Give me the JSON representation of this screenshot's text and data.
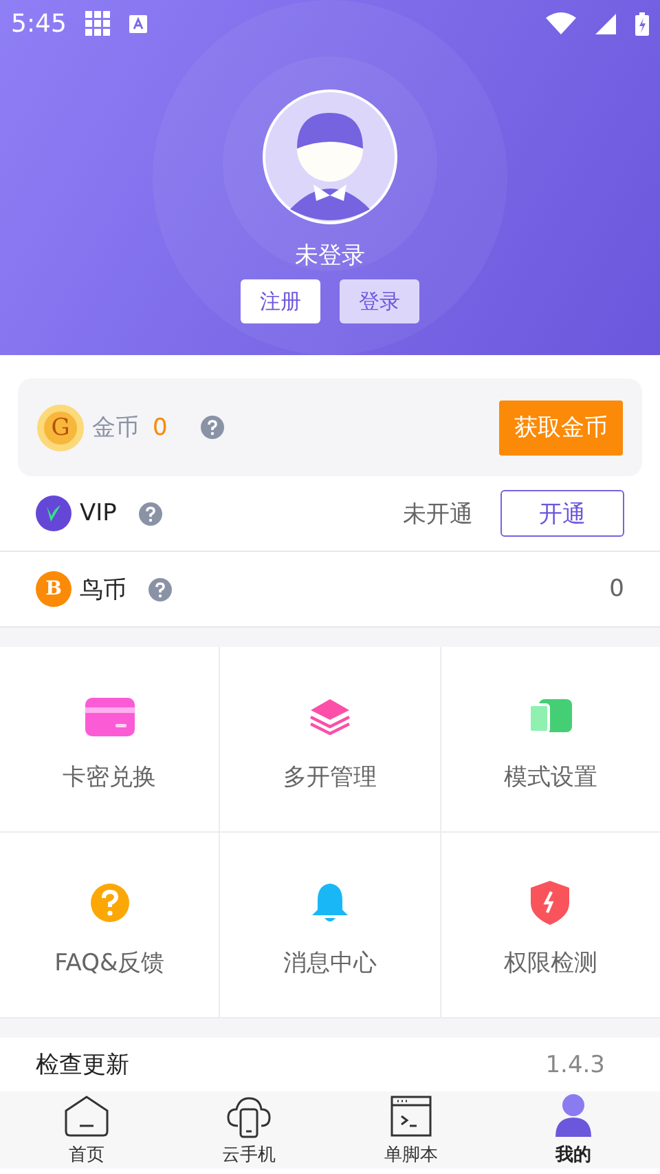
{
  "status_bar": {
    "time": "5:45"
  },
  "profile": {
    "name": "未登录",
    "buttons": [
      {
        "label": "注册",
        "kind": "outline"
      },
      {
        "label": "登录",
        "kind": "tinted"
      }
    ]
  },
  "gold": {
    "symbol": "G",
    "label": "金币",
    "amount": "0",
    "action": "获取金币"
  },
  "vip": {
    "label": "VIP",
    "status": "未开通",
    "action": "开通"
  },
  "bird_coin": {
    "symbol": "B",
    "label": "鸟币",
    "amount": "0"
  },
  "features": [
    {
      "label": "卡密兑换",
      "kind": "card"
    },
    {
      "label": "多开管理",
      "kind": "layers"
    },
    {
      "label": "模式设置",
      "kind": "mode"
    },
    {
      "label": "FAQ&反馈",
      "kind": "faq"
    },
    {
      "label": "消息中心",
      "kind": "bell"
    },
    {
      "label": "权限检测",
      "kind": "shield"
    }
  ],
  "update": {
    "label": "检查更新",
    "version": "1.4.3"
  },
  "tabs": [
    {
      "label": "首页",
      "kind": "home",
      "selected": false
    },
    {
      "label": "云手机",
      "kind": "cloud",
      "selected": false
    },
    {
      "label": "单脚本",
      "kind": "terminal",
      "selected": false
    },
    {
      "label": "我的",
      "kind": "user",
      "selected": true
    }
  ]
}
